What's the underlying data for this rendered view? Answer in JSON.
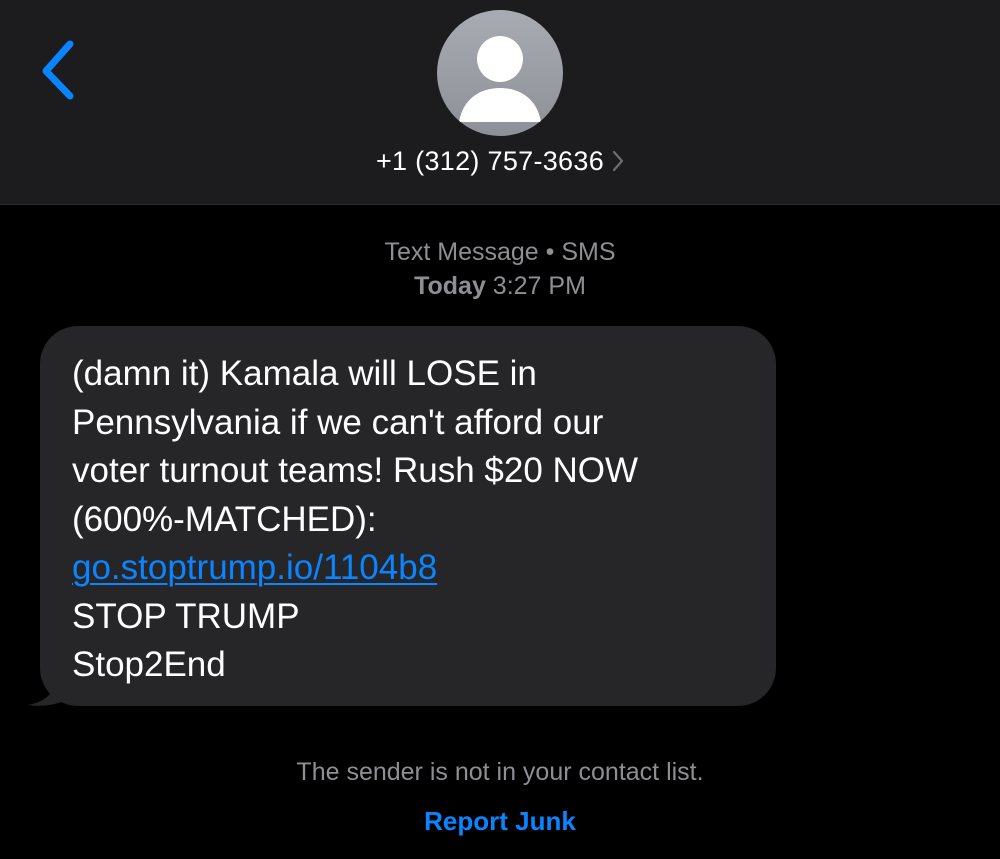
{
  "header": {
    "back_icon": "chevron-left-icon",
    "avatar_icon": "person-silhouette-icon",
    "contact_name": "+1 (312) 757-3636",
    "contact_chevron_icon": "chevron-right-icon"
  },
  "conversation": {
    "service_label": "Text Message • SMS",
    "day_label": "Today",
    "time_label": "3:27 PM"
  },
  "message": {
    "lines": [
      "(damn it) Kamala will LOSE in",
      "Pennsylvania if we can't afford our",
      "voter turnout teams! Rush $20 NOW",
      "(600%-MATCHED):"
    ],
    "link": "go.stoptrump.io/1104b8",
    "signature": [
      "STOP TRUMP",
      "Stop2End"
    ]
  },
  "footer": {
    "notice": "The sender is not in your contact list.",
    "report_label": "Report Junk"
  },
  "colors": {
    "accent": "#0a84ff",
    "header_bg": "#1c1c1e",
    "bubble_bg": "#262628",
    "secondary_text": "#8e8e93"
  }
}
